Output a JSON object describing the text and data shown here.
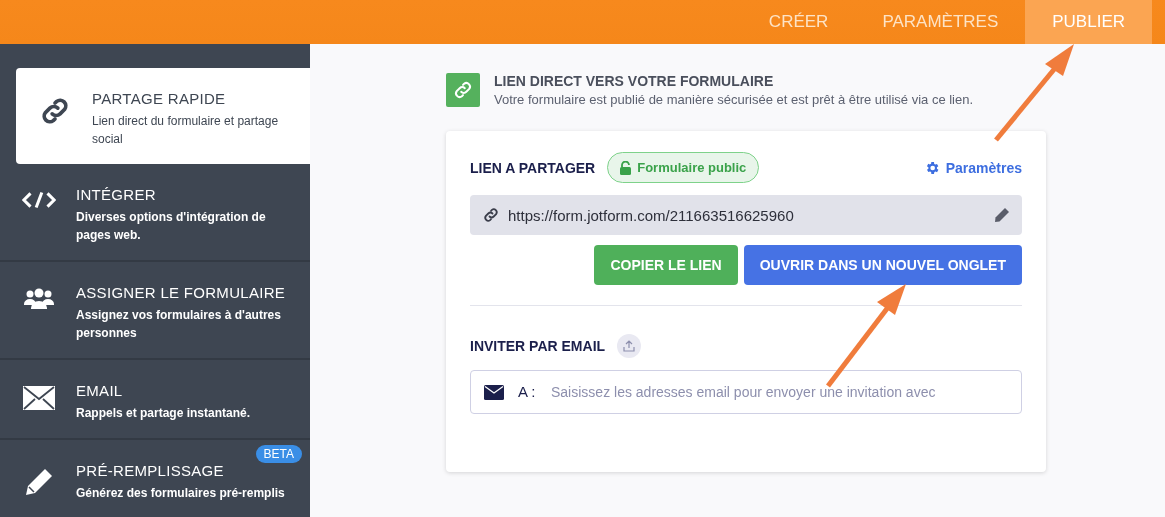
{
  "header": {
    "tabs": [
      {
        "label": "CRÉER",
        "selected": false
      },
      {
        "label": "PARAMÈTRES",
        "selected": false
      },
      {
        "label": "PUBLIER",
        "selected": true
      }
    ]
  },
  "sidebar": {
    "items": [
      {
        "kind": "link",
        "title": "PARTAGE RAPIDE",
        "description": "Lien direct du formulaire et partage social",
        "selected": true
      },
      {
        "kind": "code",
        "title": "INTÉGRER",
        "description": "Diverses options d'intégration de pages web.",
        "selected": false
      },
      {
        "kind": "users",
        "title": "ASSIGNER LE FORMULAIRE",
        "description": "Assignez vos formulaires à d'autres personnes",
        "selected": false
      },
      {
        "kind": "mail",
        "title": "EMAIL",
        "description": "Rappels et partage instantané.",
        "selected": false
      },
      {
        "kind": "pencil",
        "title": "PRÉ-REMPLISSAGE",
        "description": "Générez des formulaires pré-remplis",
        "selected": false,
        "badge": "BETA"
      }
    ]
  },
  "main": {
    "heading": "LIEN DIRECT VERS VOTRE FORMULAIRE",
    "subtitle": "Votre formulaire est publié de manière sécurisée et est prêt à être utilisé via ce lien.",
    "share": {
      "label": "LIEN A PARTAGER",
      "status_badge": "Formulaire public",
      "settings_link": "Paramètres",
      "url": "https://form.jotform.com/211663516625960",
      "buttons": [
        {
          "kind": "copy",
          "label": "COPIER LE LIEN"
        },
        {
          "kind": "open",
          "label": "OUVRIR DANS UN NOUVEL ONGLET"
        }
      ]
    },
    "invite": {
      "label": "INVITER PAR EMAIL",
      "to_label": "A :",
      "placeholder": "Saisissez les adresses email pour envoyer une invitation avec"
    }
  }
}
